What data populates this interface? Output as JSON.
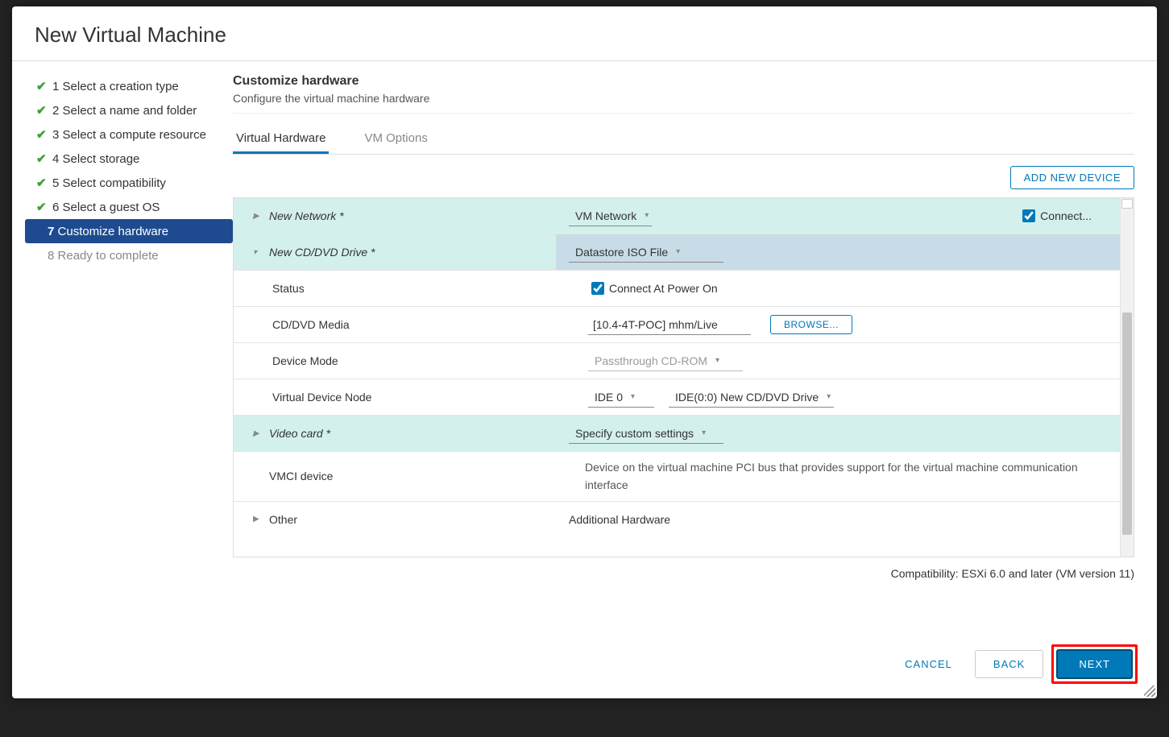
{
  "modal": {
    "title": "New Virtual Machine"
  },
  "wizard": {
    "steps": [
      {
        "num": "1",
        "label": "Select a creation type",
        "state": "done"
      },
      {
        "num": "2",
        "label": "Select a name and folder",
        "state": "done"
      },
      {
        "num": "3",
        "label": "Select a compute resource",
        "state": "done"
      },
      {
        "num": "4",
        "label": "Select storage",
        "state": "done"
      },
      {
        "num": "5",
        "label": "Select compatibility",
        "state": "done"
      },
      {
        "num": "6",
        "label": "Select a guest OS",
        "state": "done"
      },
      {
        "num": "7",
        "label": "Customize hardware",
        "state": "active"
      },
      {
        "num": "8",
        "label": "Ready to complete",
        "state": "pending"
      }
    ]
  },
  "pane": {
    "title": "Customize hardware",
    "subtitle": "Configure the virtual machine hardware",
    "tabs": {
      "hardware": "Virtual Hardware",
      "options": "VM Options"
    },
    "add_device": "ADD NEW DEVICE"
  },
  "hw": {
    "network": {
      "label": "New Network *",
      "value": "VM Network",
      "connect_label": "Connect..."
    },
    "cddvd": {
      "label": "New CD/DVD Drive *",
      "type": "Datastore ISO File",
      "status_label": "Status",
      "status_value": "Connect At Power On",
      "media_label": "CD/DVD Media",
      "media_value": "[10.4-4T-POC] mhm/Live",
      "browse": "BROWSE...",
      "mode_label": "Device Mode",
      "mode_value": "Passthrough CD-ROM",
      "node_label": "Virtual Device Node",
      "node_bus": "IDE 0",
      "node_slot": "IDE(0:0) New CD/DVD Drive"
    },
    "video": {
      "label": "Video card *",
      "value": "Specify custom settings"
    },
    "vmci": {
      "label": "VMCI device",
      "value": "Device on the virtual machine PCI bus that provides support for the virtual machine communication interface"
    },
    "other": {
      "label": "Other",
      "value": "Additional Hardware"
    }
  },
  "compat": "Compatibility: ESXi 6.0 and later (VM version 11)",
  "footer": {
    "cancel": "CANCEL",
    "back": "BACK",
    "next": "NEXT"
  }
}
